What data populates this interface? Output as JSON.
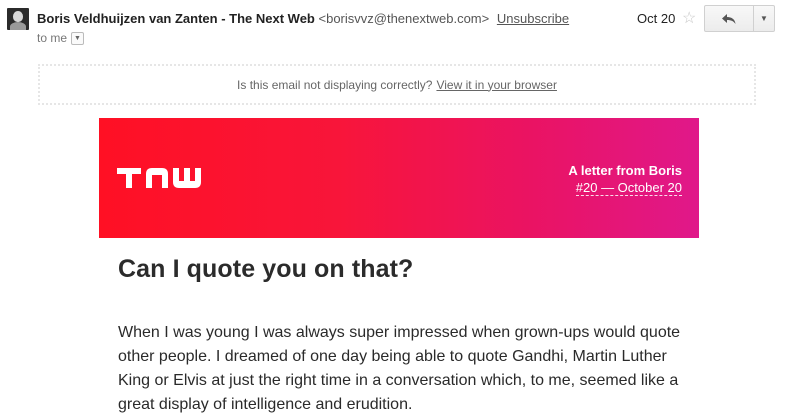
{
  "header": {
    "sender_name": "Boris Veldhuijzen van Zanten - The Next Web",
    "sender_email": "<borisvvz@thenextweb.com>",
    "unsubscribe": "Unsubscribe",
    "to": "to me",
    "to_caret_icon": "chevron-down-icon",
    "date": "Oct 20",
    "star_icon": "star-icon",
    "reply_icon": "reply-icon",
    "more_icon": "chevron-down-icon"
  },
  "email": {
    "notice_text": "Is this email not displaying correctly?",
    "notice_link": "View it in your browser",
    "banner": {
      "logo": "TNW",
      "title": "A letter from Boris",
      "subtitle": "#20 — October 20",
      "colors": {
        "start": "#ff1024",
        "end": "#e0188a"
      }
    },
    "headline": "Can I quote you on that?",
    "paragraph": "When I was young I was always super impressed when grown-ups would quote other people. I dreamed of one day being able to quote Gandhi, Martin Luther King or Elvis at just the right time in a conversation which, to me, seemed like a great display of intelligence and erudition."
  }
}
